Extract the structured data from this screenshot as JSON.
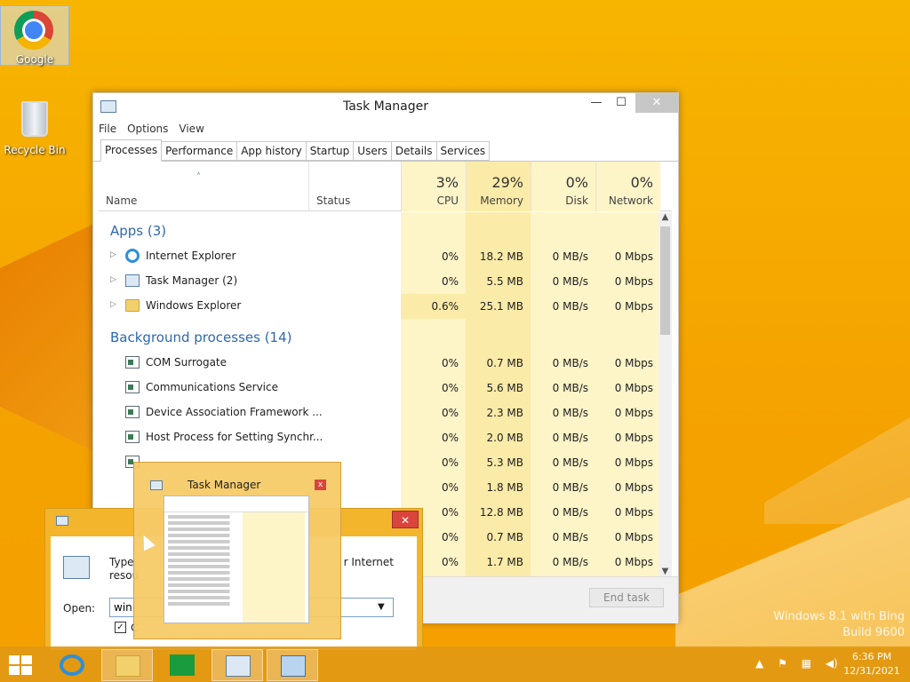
{
  "desktop": {
    "icons": [
      {
        "label": "Google"
      },
      {
        "label": "Recycle Bin"
      }
    ],
    "watermark_line1": "Windows 8.1 with Bing",
    "watermark_line2": "Build 9600"
  },
  "task_manager": {
    "title": "Task Manager",
    "menu": [
      "File",
      "Options",
      "View"
    ],
    "tabs": [
      "Processes",
      "Performance",
      "App history",
      "Startup",
      "Users",
      "Details",
      "Services"
    ],
    "active_tab": "Processes",
    "columns": {
      "name": "Name",
      "status": "Status",
      "cpu": {
        "pct": "3%",
        "label": "CPU"
      },
      "memory": {
        "pct": "29%",
        "label": "Memory"
      },
      "disk": {
        "pct": "0%",
        "label": "Disk"
      },
      "network": {
        "pct": "0%",
        "label": "Network"
      }
    },
    "groups": {
      "apps": "Apps (3)",
      "background": "Background processes (14)"
    },
    "apps": [
      {
        "name": "Internet Explorer",
        "icon": "internet-explorer-icon",
        "cpu": "0%",
        "memory": "18.2 MB",
        "disk": "0 MB/s",
        "network": "0 Mbps"
      },
      {
        "name": "Task Manager (2)",
        "icon": "task-manager-icon",
        "cpu": "0%",
        "memory": "5.5 MB",
        "disk": "0 MB/s",
        "network": "0 Mbps"
      },
      {
        "name": "Windows Explorer",
        "icon": "folder-icon",
        "cpu": "0.6%",
        "memory": "25.1 MB",
        "disk": "0 MB/s",
        "network": "0 Mbps"
      }
    ],
    "background": [
      {
        "name": "COM Surrogate",
        "cpu": "0%",
        "memory": "0.7 MB",
        "disk": "0 MB/s",
        "network": "0 Mbps"
      },
      {
        "name": "Communications Service",
        "cpu": "0%",
        "memory": "5.6 MB",
        "disk": "0 MB/s",
        "network": "0 Mbps"
      },
      {
        "name": "Device Association Framework ...",
        "cpu": "0%",
        "memory": "2.3 MB",
        "disk": "0 MB/s",
        "network": "0 Mbps"
      },
      {
        "name": "Host Process for Setting Synchr...",
        "cpu": "0%",
        "memory": "2.0 MB",
        "disk": "0 MB/s",
        "network": "0 Mbps"
      },
      {
        "name": "",
        "cpu": "0%",
        "memory": "5.3 MB",
        "disk": "0 MB/s",
        "network": "0 Mbps"
      },
      {
        "name": "",
        "cpu": "0%",
        "memory": "1.8 MB",
        "disk": "0 MB/s",
        "network": "0 Mbps"
      },
      {
        "name": "",
        "cpu": "0%",
        "memory": "12.8 MB",
        "disk": "0 MB/s",
        "network": "0 Mbps"
      },
      {
        "name": "",
        "cpu": "0%",
        "memory": "0.7 MB",
        "disk": "0 MB/s",
        "network": "0 Mbps"
      },
      {
        "name": "",
        "cpu": "0%",
        "memory": "1.7 MB",
        "disk": "0 MB/s",
        "network": "0 Mbps"
      }
    ],
    "end_task": "End task",
    "heat_color": "#fdf4c8",
    "heat_color_strong": "#fbeba8"
  },
  "run_dialog": {
    "text_left": "Type",
    "text_left2": "resou",
    "text_right": "r Internet",
    "open_label": "Open:",
    "open_value": "wini",
    "checkbox_mark": "✓",
    "checkbox_text": "C"
  },
  "preview": {
    "title": "Task Manager",
    "close": "x"
  },
  "taskbar": {
    "time": "6:36 PM",
    "date": "12/31/2021"
  }
}
